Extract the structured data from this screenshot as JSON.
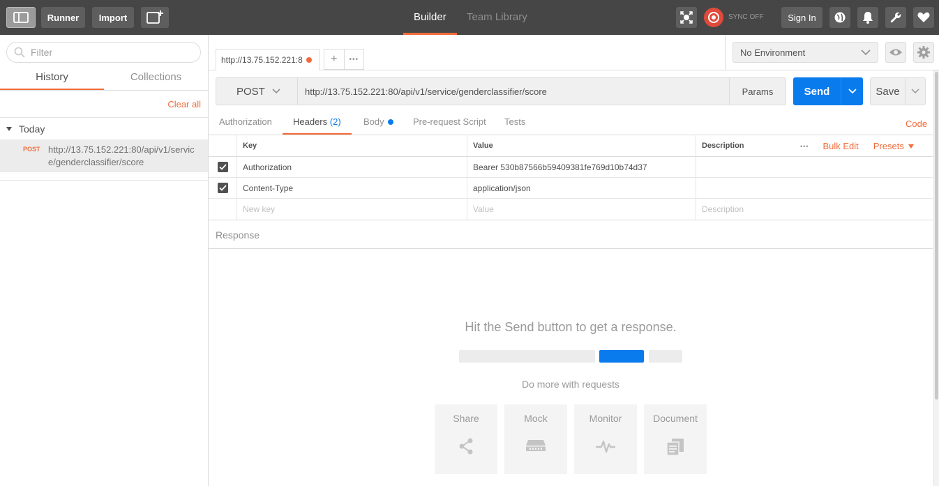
{
  "topbar": {
    "runner_label": "Runner",
    "import_label": "Import",
    "builder_label": "Builder",
    "team_library_label": "Team Library",
    "sync_label": "SYNC OFF",
    "sign_in_label": "Sign In"
  },
  "sidebar": {
    "filter_placeholder": "Filter",
    "tabs": [
      {
        "label": "History"
      },
      {
        "label": "Collections"
      }
    ],
    "clear_all_label": "Clear all",
    "group_label": "Today",
    "history": [
      {
        "method": "POST",
        "url": "http://13.75.152.221:80/api/v1/service/genderclassifier/score"
      }
    ]
  },
  "request_tab": {
    "title": "http://13.75.152.221:8",
    "new_tab_label": "+",
    "more_label": "•••"
  },
  "environment": {
    "selected": "No Environment"
  },
  "request": {
    "method": "POST",
    "url": "http://13.75.152.221:80/api/v1/service/genderclassifier/score",
    "params_label": "Params",
    "send_label": "Send",
    "save_label": "Save"
  },
  "subtabs": {
    "authorization": "Authorization",
    "headers": "Headers",
    "headers_count": "(2)",
    "body": "Body",
    "prerequest": "Pre-request Script",
    "tests": "Tests",
    "code": "Code"
  },
  "headers_table": {
    "columns": {
      "key": "Key",
      "value": "Value",
      "description": "Description"
    },
    "more_label": "•••",
    "bulk_edit_label": "Bulk Edit",
    "presets_label": "Presets",
    "rows": [
      {
        "key": "Authorization",
        "value": "Bearer 530b87566b59409381fe769d10b74d37",
        "description": ""
      },
      {
        "key": "Content-Type",
        "value": "application/json",
        "description": ""
      }
    ],
    "new_row": {
      "key": "New key",
      "value": "Value",
      "description": "Description"
    }
  },
  "response": {
    "label": "Response",
    "empty_title": "Hit the Send button to get a response.",
    "more_text": "Do more with requests",
    "cards": [
      {
        "label": "Share",
        "icon": "share-icon"
      },
      {
        "label": "Mock",
        "icon": "mock-server-icon"
      },
      {
        "label": "Monitor",
        "icon": "monitor-pulse-icon"
      },
      {
        "label": "Document",
        "icon": "document-icon"
      }
    ]
  },
  "colors": {
    "accent": "#f26b3a",
    "primary": "#097bed",
    "topbar": "#464646"
  }
}
